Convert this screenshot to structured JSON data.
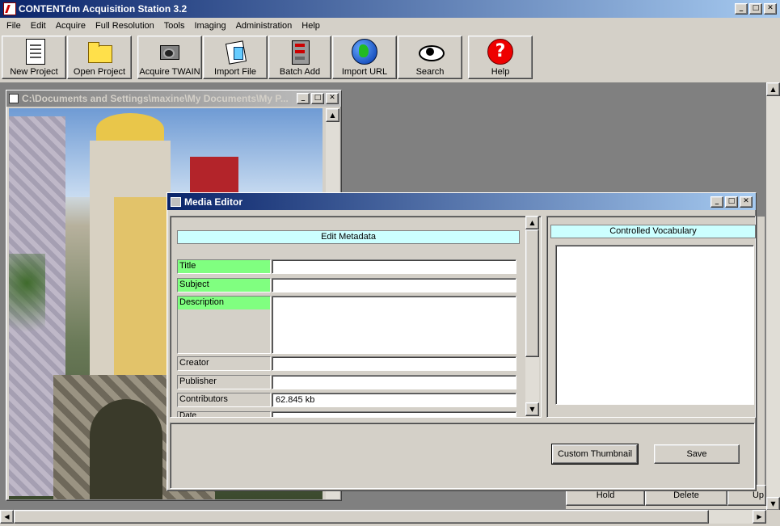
{
  "app": {
    "title": "CONTENTdm Acquisition Station 3.2"
  },
  "menu": [
    "File",
    "Edit",
    "Acquire",
    "Full Resolution",
    "Tools",
    "Imaging",
    "Administration",
    "Help"
  ],
  "toolbar": [
    {
      "label": "New Project",
      "icon": "new-project-icon"
    },
    {
      "label": "Open Project",
      "icon": "folder-icon"
    },
    {
      "label": "Acquire TWAIN",
      "icon": "camera-icon"
    },
    {
      "label": "Import File",
      "icon": "import-file-icon"
    },
    {
      "label": "Batch Add",
      "icon": "batch-add-icon"
    },
    {
      "label": "Import URL",
      "icon": "globe-icon"
    },
    {
      "label": "Search",
      "icon": "eye-icon"
    },
    {
      "label": "Help",
      "icon": "help-icon"
    }
  ],
  "image_window": {
    "title": "C:\\Documents and Settings\\maxine\\My Documents\\My P..."
  },
  "media_editor": {
    "title": "Media Editor",
    "edit_metadata_heading": "Edit Metadata",
    "controlled_vocabulary_heading": "Controlled Vocabulary",
    "fields": [
      {
        "label": "Title",
        "value": "",
        "required": true
      },
      {
        "label": "Subject",
        "value": "",
        "required": true
      },
      {
        "label": "Description",
        "value": "",
        "required": true
      },
      {
        "label": "Creator",
        "value": "",
        "required": false
      },
      {
        "label": "Publisher",
        "value": "",
        "required": false
      },
      {
        "label": "Contributors",
        "value": "62.845 kb",
        "required": false
      },
      {
        "label": "Date",
        "value": "",
        "required": false
      }
    ],
    "buttons": {
      "custom_thumbnail": "Custom Thumbnail",
      "save": "Save"
    }
  },
  "background_buttons": [
    "Hold",
    "Delete",
    "Up"
  ],
  "window_controls": {
    "minimize": "_",
    "maximize": "□",
    "close": "✕"
  },
  "colors": {
    "title_active": "#0a246a",
    "title_inactive": "#808080",
    "required_field": "#80ff80",
    "section_header": "#ccffff"
  }
}
